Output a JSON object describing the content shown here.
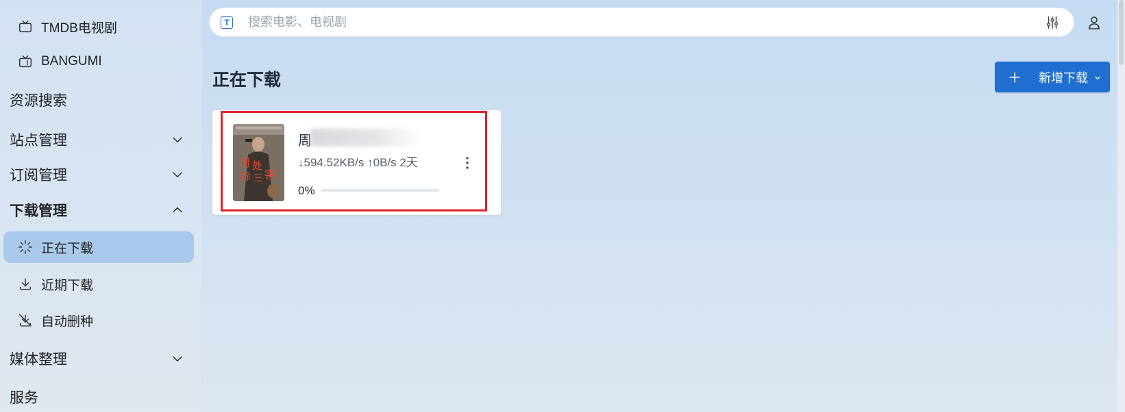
{
  "sidebar": {
    "items": [
      {
        "label": "TMDB电视剧",
        "icon": "tv-icon"
      },
      {
        "label": "BANGUMI",
        "icon": "retro-tv-icon"
      },
      {
        "label": "资源搜索"
      },
      {
        "label": "站点管理",
        "icon": "chevron-down-icon"
      },
      {
        "label": "订阅管理",
        "icon": "chevron-down-icon"
      },
      {
        "label": "下载管理",
        "icon": "chevron-up-icon"
      },
      {
        "label": "正在下载",
        "icon": "loader-icon",
        "active": true
      },
      {
        "label": "近期下载",
        "icon": "download-icon"
      },
      {
        "label": "自动删种",
        "icon": "download-off-icon"
      },
      {
        "label": "媒体整理",
        "icon": "chevron-down-icon"
      },
      {
        "label": "服务"
      }
    ]
  },
  "search": {
    "placeholder": "搜索电影、电视剧",
    "value": "",
    "prefix_icon": "t-box-icon",
    "filter_icon": "sliders-icon"
  },
  "header": {
    "user_icon": "user-icon"
  },
  "main": {
    "title": "正在下载",
    "add_button": {
      "label": "新增下载",
      "icon": "plus-icon",
      "caret": "chevron-down-icon"
    }
  },
  "downloads": [
    {
      "title": "周",
      "speed": "↓594.52KB/s ↑0B/s 2天",
      "percent_label": "0%",
      "progress": 0
    }
  ],
  "colors": {
    "accent": "#1e6fd0",
    "active_nav": "#a9c9ec",
    "highlight": "#e0212a"
  }
}
